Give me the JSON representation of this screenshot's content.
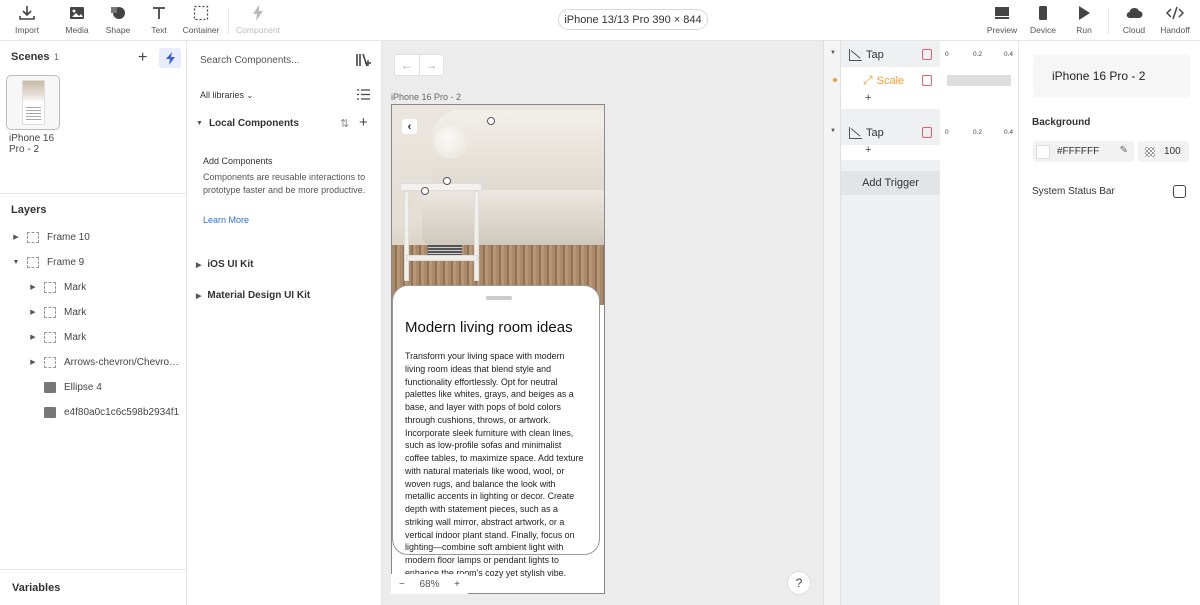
{
  "toolbar": {
    "tools": [
      {
        "label": "Import",
        "icon": "import-icon"
      },
      {
        "label": "Media",
        "icon": "media-icon"
      },
      {
        "label": "Shape",
        "icon": "shape-icon"
      },
      {
        "label": "Text",
        "icon": "text-icon"
      },
      {
        "label": "Container",
        "icon": "container-icon"
      },
      {
        "label": "Component",
        "icon": "component-icon",
        "disabled": true
      }
    ],
    "device": "iPhone 13/13 Pro  390 × 844",
    "right_tools": [
      {
        "label": "Preview",
        "icon": "preview-icon"
      },
      {
        "label": "Device",
        "icon": "device-icon"
      },
      {
        "label": "Run",
        "icon": "run-icon"
      },
      {
        "label": "Cloud",
        "icon": "cloud-icon"
      },
      {
        "label": "Handoff",
        "icon": "code-icon"
      }
    ]
  },
  "scenes": {
    "title": "Scenes",
    "count": "1",
    "items": [
      {
        "name": "iPhone 16 Pro - 2"
      }
    ]
  },
  "layers": {
    "title": "Layers",
    "items": [
      {
        "name": "Frame 10",
        "type": "frame",
        "caret": "▶"
      },
      {
        "name": "Frame 9",
        "type": "frame",
        "caret": "▼"
      },
      {
        "name": "Mark",
        "type": "frame",
        "caret": "▶"
      },
      {
        "name": "Mark",
        "type": "frame",
        "caret": "▶"
      },
      {
        "name": "Mark",
        "type": "frame",
        "caret": "▶"
      },
      {
        "name": "Arrows-chevron/Chevron-left",
        "type": "frame",
        "caret": "▶"
      },
      {
        "name": "Ellipse 4",
        "type": "image",
        "caret": ""
      },
      {
        "name": "e4f80a0c1c6c598b2934f1",
        "type": "image",
        "caret": ""
      }
    ]
  },
  "variables": {
    "title": "Variables"
  },
  "components": {
    "search_placeholder": "Search Components...",
    "library_filter": "All libraries",
    "local": "Local Components",
    "add_title": "Add Components",
    "add_desc": "Components are reusable interactions to prototype faster and be more productive.",
    "learn_more": "Learn More",
    "kits": [
      "iOS UI Kit",
      "Material Design UI Kit"
    ]
  },
  "canvas": {
    "frame_label": "iPhone 16 Pro - 2",
    "sheet_title": "Modern living room ideas",
    "sheet_body": "Transform your living space with modern living room ideas that blend style and functionality effortlessly. Opt for neutral palettes like whites, grays, and beiges as a base, and layer with pops of bold colors through cushions, throws, or artwork. Incorporate sleek furniture with clean lines, such as low-profile sofas and minimalist coffee tables, to maximize space. Add texture with natural materials like wood, wool, or woven rugs, and balance the look with metallic accents in lighting or decor. Create depth with statement pieces, such as a striking wall mirror, abstract artwork, or a vertical indoor plant stand. Finally, focus on lighting—combine soft ambient light with modern floor lamps or pendant lights to enhance the room's cozy yet stylish vibe.",
    "zoom": "68%",
    "help": "?"
  },
  "interactions": {
    "triggers": [
      {
        "label": "Tap",
        "animations": [
          {
            "label": "Scale"
          }
        ]
      },
      {
        "label": "Tap",
        "animations": []
      }
    ],
    "add_trigger": "Add Trigger",
    "timeline_ticks": [
      "0",
      "0.2",
      "0.4"
    ]
  },
  "properties": {
    "name": "iPhone 16 Pro - 2",
    "background_label": "Background",
    "background_color": "#FFFFFF",
    "opacity": "100",
    "status_bar_label": "System Status Bar",
    "status_bar_checked": false
  }
}
